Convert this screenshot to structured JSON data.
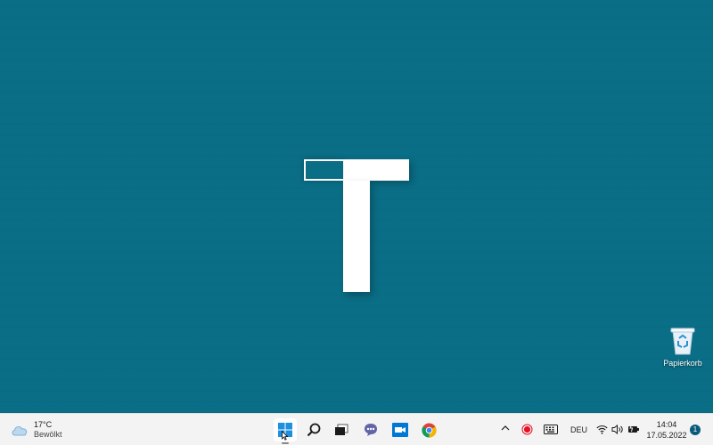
{
  "desktop": {
    "background_color": "#0a6e86",
    "recycle_bin": {
      "label": "Papierkorb",
      "icon": "recycle-bin-icon"
    }
  },
  "taskbar": {
    "weather": {
      "temperature": "17°C",
      "condition": "Bewölkt",
      "icon": "cloud-icon"
    },
    "apps": [
      {
        "name": "start",
        "icon": "windows-start-icon"
      },
      {
        "name": "search",
        "icon": "search-icon"
      },
      {
        "name": "task-view",
        "icon": "task-view-icon"
      },
      {
        "name": "chat",
        "icon": "chat-icon"
      },
      {
        "name": "meet",
        "icon": "meet-now-icon"
      },
      {
        "name": "chrome",
        "icon": "chrome-icon"
      }
    ],
    "tray": {
      "language": "DEU",
      "time": "14:04",
      "date": "17.05.2022",
      "notification_count": "1"
    }
  },
  "colors": {
    "accent": "#0a6e86",
    "taskbar": "#f3f3f3",
    "recording": "#e81123"
  }
}
